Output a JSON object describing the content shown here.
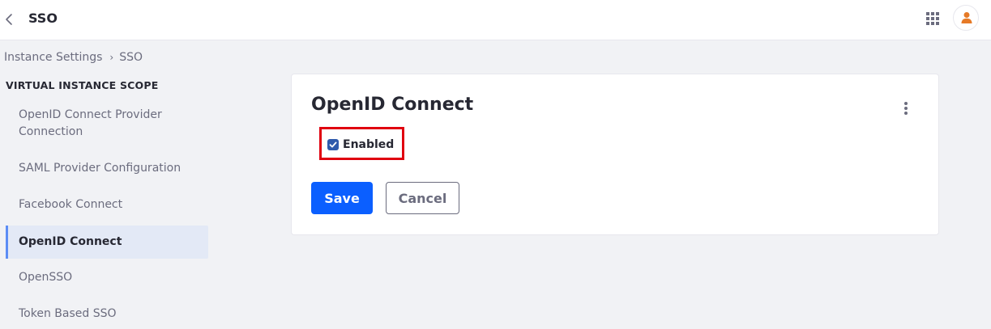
{
  "header": {
    "title": "SSO",
    "back_icon": "chevron-left-icon",
    "apps_icon": "grid-icon",
    "avatar_icon": "user-icon",
    "avatar_color": "#e67a27"
  },
  "breadcrumb": {
    "items": [
      "Instance Settings",
      "SSO"
    ]
  },
  "sidebar": {
    "heading": "VIRTUAL INSTANCE SCOPE",
    "items": [
      {
        "label": "OpenID Connect Provider Connection",
        "active": false
      },
      {
        "label": "SAML Provider Configuration",
        "active": false
      },
      {
        "label": "Facebook Connect",
        "active": false
      },
      {
        "label": "OpenID Connect",
        "active": true
      },
      {
        "label": "OpenSSO",
        "active": false
      },
      {
        "label": "Token Based SSO",
        "active": false
      }
    ]
  },
  "form": {
    "title": "OpenID Connect",
    "enabled_label": "Enabled",
    "enabled_checked": true,
    "save_label": "Save",
    "cancel_label": "Cancel",
    "options_icon": "kebab-menu-icon",
    "highlight_color": "#e0000f"
  },
  "colors": {
    "primary": "#0b5fff",
    "active_nav_bg": "#e3e9f6",
    "active_nav_border": "#5c8df5",
    "background": "#f1f2f5"
  }
}
